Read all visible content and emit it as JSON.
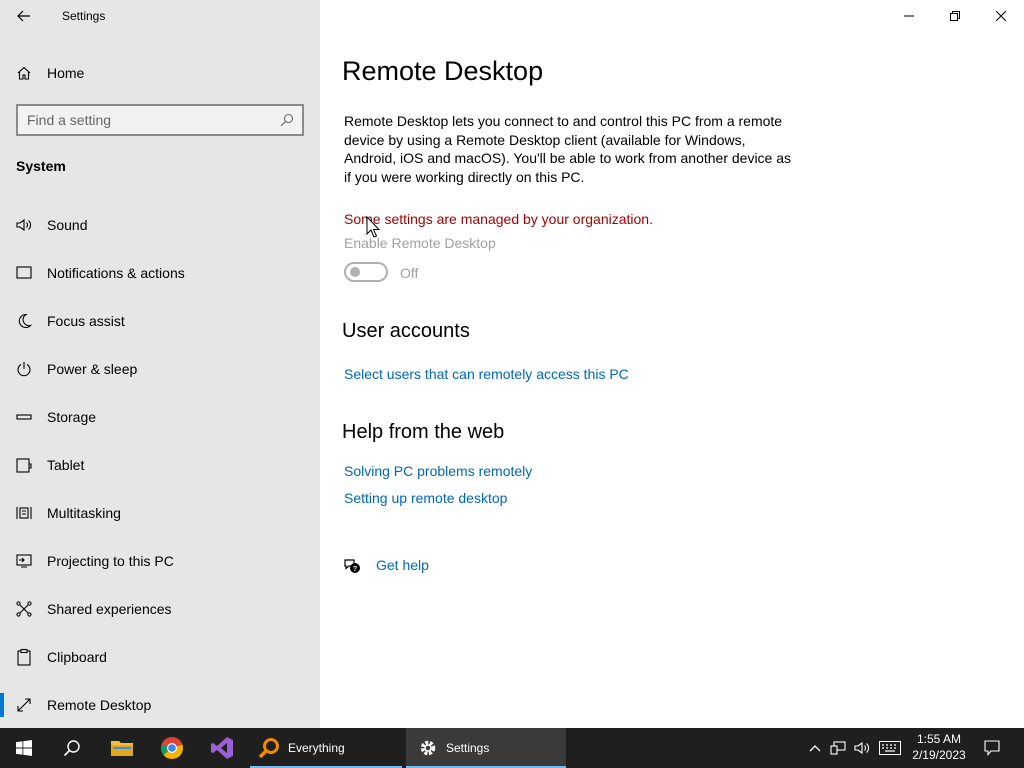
{
  "window": {
    "title": "Settings"
  },
  "sidebar": {
    "home_label": "Home",
    "search_placeholder": "Find a setting",
    "section_title": "System",
    "items": [
      {
        "label": "Sound",
        "icon": "speaker-icon"
      },
      {
        "label": "Notifications & actions",
        "icon": "message-icon"
      },
      {
        "label": "Focus assist",
        "icon": "moon-icon"
      },
      {
        "label": "Power & sleep",
        "icon": "power-icon"
      },
      {
        "label": "Storage",
        "icon": "drive-icon"
      },
      {
        "label": "Tablet",
        "icon": "tablet-icon"
      },
      {
        "label": "Multitasking",
        "icon": "multitasking-icon"
      },
      {
        "label": "Projecting to this PC",
        "icon": "projector-icon"
      },
      {
        "label": "Shared experiences",
        "icon": "share-icon"
      },
      {
        "label": "Clipboard",
        "icon": "clipboard-icon"
      },
      {
        "label": "Remote Desktop",
        "icon": "remote-desktop-icon",
        "active": true
      }
    ]
  },
  "main": {
    "title": "Remote Desktop",
    "description": "Remote Desktop lets you connect to and control this PC from a remote device by using a Remote Desktop client (available for Windows, Android, iOS and macOS). You'll be able to work from another device as if you were working directly on this PC.",
    "managed_notice": "Some settings are managed by your organization.",
    "enable_label": "Enable Remote Desktop",
    "toggle_state": "Off",
    "user_accounts_heading": "User accounts",
    "user_accounts_link": "Select users that can remotely access this PC",
    "help_heading": "Help from the web",
    "help_links": [
      "Solving PC problems remotely",
      "Setting up remote desktop"
    ],
    "get_help": "Get help"
  },
  "taskbar": {
    "apps": [
      {
        "label": "Everything",
        "icon": "everything-search-icon"
      },
      {
        "label": "Settings",
        "icon": "gear-icon",
        "active": true
      }
    ],
    "time": "1:55 AM",
    "date": "2/19/2023"
  },
  "colors": {
    "accent": "#0078d7",
    "link": "#0067b8",
    "warning": "#a80000",
    "sidebar_bg": "#e6e6e6",
    "taskbar_bg": "#1f1f1f"
  }
}
